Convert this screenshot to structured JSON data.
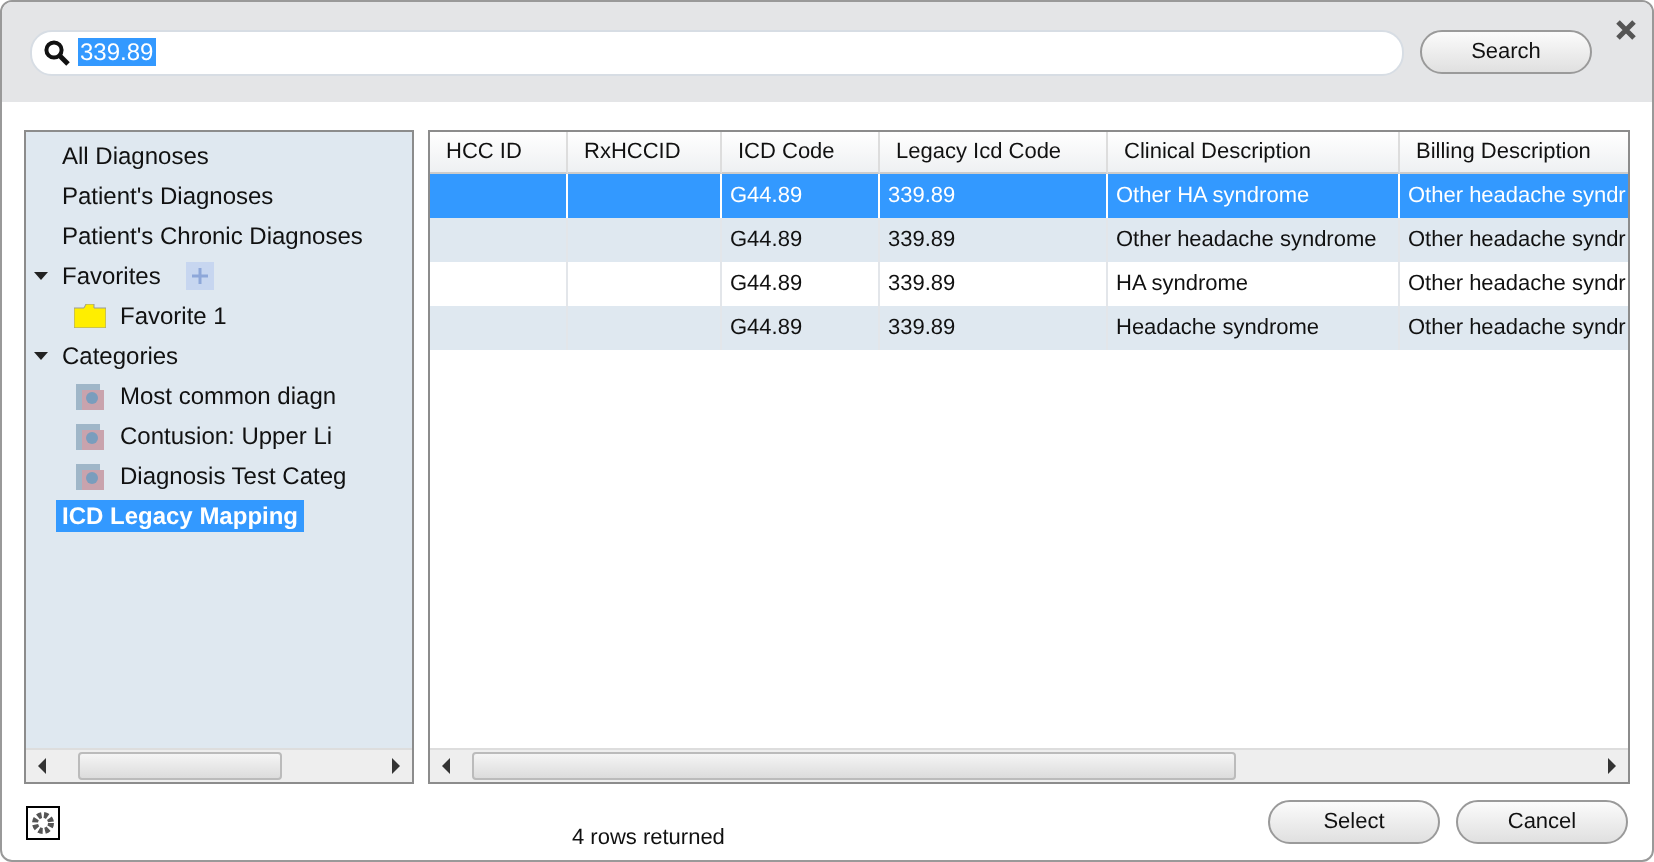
{
  "search": {
    "value": "339.89",
    "button": "Search"
  },
  "tree": [
    {
      "label": "All Diagnoses",
      "selected": false
    },
    {
      "label": "Patient's Diagnoses",
      "selected": false
    },
    {
      "label": "Patient's Chronic Diagnoses",
      "selected": false
    },
    {
      "label": "Favorites",
      "selected": false,
      "expanded": true,
      "can_add": true,
      "children": [
        {
          "label": "Favorite 1",
          "kind": "folder",
          "selected": false
        }
      ]
    },
    {
      "label": "Categories",
      "selected": false,
      "expanded": true,
      "children": [
        {
          "label": "Most common diagn",
          "kind": "category",
          "selected": false
        },
        {
          "label": "Contusion: Upper Li",
          "kind": "category",
          "selected": false
        },
        {
          "label": "Diagnosis Test Categ",
          "kind": "category",
          "selected": false
        }
      ]
    },
    {
      "label": "ICD Legacy Mapping",
      "selected": true
    }
  ],
  "table": {
    "columns": [
      "HCC ID",
      "RxHCCID",
      "ICD Code",
      "Legacy Icd Code",
      "Clinical Description",
      "Billing Description"
    ],
    "rows": [
      {
        "selected": true,
        "cells": [
          "",
          "",
          "G44.89",
          "339.89",
          "Other HA syndrome",
          "Other headache syndr"
        ]
      },
      {
        "selected": false,
        "cells": [
          "",
          "",
          "G44.89",
          "339.89",
          "Other headache syndrome",
          "Other headache syndr"
        ]
      },
      {
        "selected": false,
        "cells": [
          "",
          "",
          "G44.89",
          "339.89",
          "HA syndrome",
          "Other headache syndr"
        ]
      },
      {
        "selected": false,
        "cells": [
          "",
          "",
          "G44.89",
          "339.89",
          "Headache syndrome",
          "Other headache syndr"
        ]
      }
    ]
  },
  "status": "4 rows returned",
  "buttons": [
    "Select",
    "Cancel"
  ]
}
